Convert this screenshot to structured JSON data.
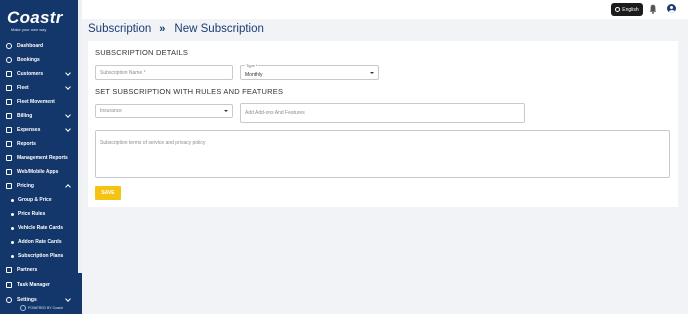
{
  "brand": {
    "logo_text": "Coastr",
    "tagline": "Make your own way"
  },
  "sidebar": {
    "items": [
      {
        "label": "Dashboard"
      },
      {
        "label": "Bookings"
      },
      {
        "label": "Customers"
      },
      {
        "label": "Fleet"
      },
      {
        "label": "Fleet Movement"
      },
      {
        "label": "Billing"
      },
      {
        "label": "Expenses"
      },
      {
        "label": "Reports"
      },
      {
        "label": "Management Reports"
      },
      {
        "label": "Web/Mobile Apps"
      },
      {
        "label": "Pricing"
      }
    ],
    "pricing_sub": [
      {
        "label": "Group & Price"
      },
      {
        "label": "Price Rules"
      },
      {
        "label": "Vehicle Rate Cards"
      },
      {
        "label": "Addon Rate Cards"
      },
      {
        "label": "Subscription Plans"
      }
    ],
    "items_after": [
      {
        "label": "Partners"
      },
      {
        "label": "Task Manager"
      },
      {
        "label": "Settings"
      }
    ],
    "powered_by": "POWERED BY Coastr"
  },
  "topbar": {
    "language": "English"
  },
  "breadcrumb": {
    "parent": "Subscription",
    "separator": "»",
    "current": "New Subscription"
  },
  "form": {
    "details_title": "SUBSCRIPTION DETAILS",
    "name_placeholder": "Subscription Name *",
    "type_label": "Type *",
    "type_value": "Monthly",
    "rules_title": "SET SUBSCRIPTION WITH RULES AND FEATURES",
    "insurance_placeholder": "Insurance",
    "addons_placeholder": "Add Add-ons And Features",
    "terms_placeholder": "Subscription terms of service and privacy policy",
    "save_label": "SAVE"
  }
}
